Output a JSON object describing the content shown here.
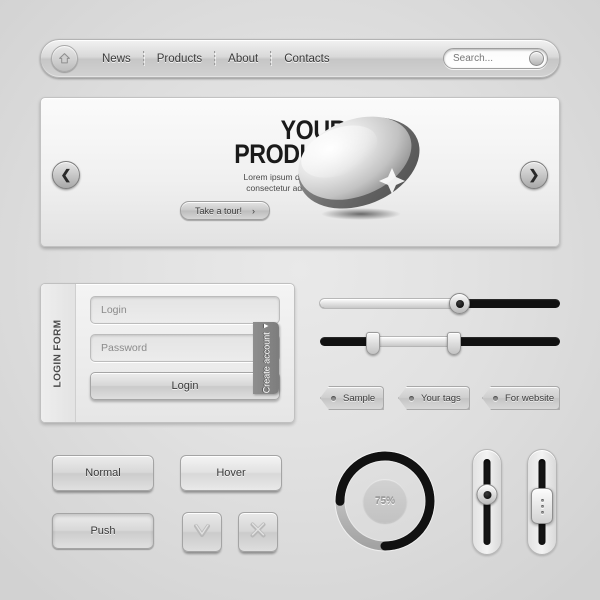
{
  "navbar": {
    "home_icon": "home-icon",
    "items": [
      {
        "label": "News"
      },
      {
        "label": "Products"
      },
      {
        "label": "About"
      },
      {
        "label": "Contacts"
      }
    ],
    "search": {
      "placeholder": "Search...",
      "value": ""
    }
  },
  "hero": {
    "title_line1": "YOUR",
    "title_line2": "PRODUCT",
    "subtitle_line1": "Lorem ipsum dolor sit amet",
    "subtitle_line2": "consectetur adipiscing elit!",
    "cta_label": "Take a tour!",
    "cta_chevron": "›",
    "prev_arrow": "❮",
    "next_arrow": "❯"
  },
  "login_form": {
    "panel_label": "LOGIN FORM",
    "login_placeholder": "Login",
    "login_value": "",
    "password_placeholder": "Password",
    "password_value": "",
    "submit_label": "Login",
    "create_account_label": "Create account",
    "create_account_chevron": "▾"
  },
  "sliders": {
    "horizontal_single": {
      "value_percent": 58
    },
    "horizontal_range": {
      "start_percent": 22,
      "end_percent": 56
    },
    "vertical_round": {
      "value_percent": 62
    },
    "vertical_rect": {
      "value_percent": 40
    }
  },
  "tags": [
    {
      "label": "Sample"
    },
    {
      "label": "Your tags"
    },
    {
      "label": "For website"
    }
  ],
  "buttons": {
    "normal_label": "Normal",
    "hover_label": "Hover",
    "push_label": "Push",
    "accept_icon": "check-icon",
    "reject_icon": "close-icon"
  },
  "progress": {
    "value_label": "75%",
    "value_percent": 75
  },
  "colors": {
    "background": "#e2e2e2",
    "panel": "#f0f0f0",
    "track_dark": "#111111",
    "text": "#3b3b3b",
    "accent_tab": "#7d7d7d"
  }
}
